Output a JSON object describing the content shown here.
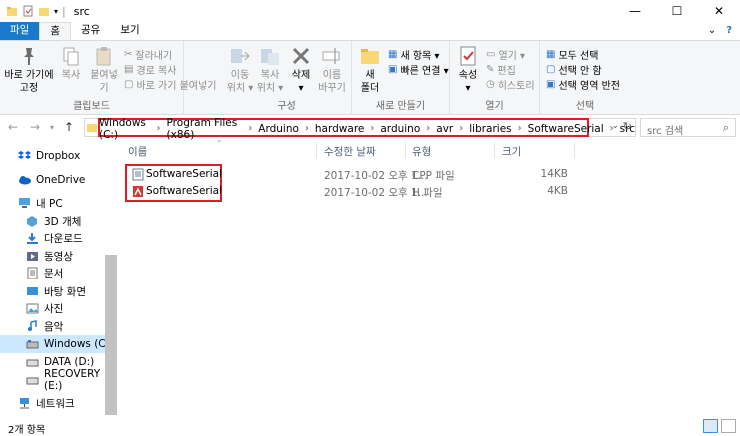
{
  "window": {
    "title": "src",
    "minimize": "—",
    "maximize": "☐",
    "close": "✕"
  },
  "tabs": [
    {
      "label": "파일"
    },
    {
      "label": "홈"
    },
    {
      "label": "공유"
    },
    {
      "label": "보기"
    }
  ],
  "ribbon": {
    "clipboard": {
      "pin": "바로 가기에\n고정",
      "copy": "복사",
      "paste": "붙여넣기",
      "cut": "잘라내기",
      "copy_path": "경로 복사",
      "paste_shortcut": "바로 가기 붙여넣기",
      "label": "클립보드"
    },
    "organize": {
      "move": "이동\n위치 ▾",
      "copy_to": "복사\n위치 ▾",
      "delete": "삭제\n▾",
      "rename": "이름\n바꾸기",
      "label": "구성"
    },
    "new": {
      "folder": "새\n폴더",
      "new_item": "새 항목 ▾",
      "easy_access": "빠른 연결 ▾",
      "label": "새로 만들기"
    },
    "open": {
      "properties": "속성\n▾",
      "open": "열기 ▾",
      "edit": "편집",
      "history": "히스토리",
      "label": "열기"
    },
    "select": {
      "all": "모두 선택",
      "none": "선택 안 함",
      "invert": "선택 영역 반전",
      "label": "선택"
    }
  },
  "address": {
    "crumbs": [
      "Windows (C:)",
      "Program Files (x86)",
      "Arduino",
      "hardware",
      "arduino",
      "avr",
      "libraries",
      "SoftwareSerial",
      "src"
    ],
    "search_placeholder": "src 검색"
  },
  "sidebar": [
    {
      "label": "Dropbox"
    },
    {
      "label": "OneDrive"
    },
    {
      "label": "내 PC"
    },
    {
      "label": "3D 개체"
    },
    {
      "label": "다운로드"
    },
    {
      "label": "동영상"
    },
    {
      "label": "문서"
    },
    {
      "label": "바탕 화면"
    },
    {
      "label": "사진"
    },
    {
      "label": "음악"
    },
    {
      "label": "Windows (C:)"
    },
    {
      "label": "DATA (D:)"
    },
    {
      "label": "RECOVERY (E:)"
    },
    {
      "label": "네트워크"
    }
  ],
  "columns": {
    "name": "이름",
    "date": "수정한 날짜",
    "type": "유형",
    "size": "크기"
  },
  "files": [
    {
      "name": "SoftwareSerial",
      "date": "2017-10-02 오후 1...",
      "type": "CPP 파일",
      "size": "14KB"
    },
    {
      "name": "SoftwareSerial",
      "date": "2017-10-02 오후 1...",
      "type": "H 파일",
      "size": "4KB"
    }
  ],
  "status": {
    "count": "2개 항목"
  },
  "colors": {
    "accent": "#1979ca",
    "highlight": "#e11c24",
    "selected": "#cce8ff"
  }
}
